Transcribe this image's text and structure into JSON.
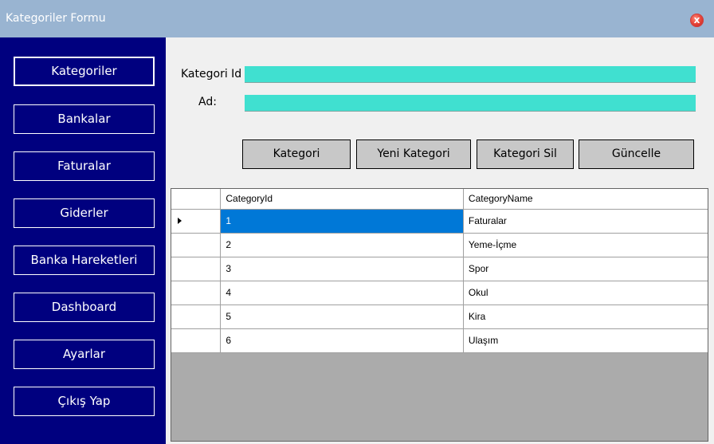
{
  "window": {
    "title": "Kategoriler Formu",
    "close_glyph": "x",
    "close_icon": "close-icon"
  },
  "sidebar": {
    "items": [
      {
        "label": "Kategoriler"
      },
      {
        "label": "Bankalar"
      },
      {
        "label": "Faturalar"
      },
      {
        "label": "Giderler"
      },
      {
        "label": "Banka Hareketleri"
      },
      {
        "label": "Dashboard"
      },
      {
        "label": "Ayarlar"
      },
      {
        "label": "Çıkış Yap"
      }
    ]
  },
  "form": {
    "id_label": "Kategori Id",
    "id_value": "",
    "name_label": "Ad:",
    "name_value": ""
  },
  "actions": {
    "list": "Kategori",
    "add": "Yeni Kategori",
    "delete": "Kategori Sil",
    "update": "Güncelle"
  },
  "grid": {
    "columns": [
      "CategoryId",
      "CategoryName"
    ],
    "rows": [
      {
        "id": "1",
        "name": "Faturalar"
      },
      {
        "id": "2",
        "name": "Yeme-İçme"
      },
      {
        "id": "3",
        "name": "Spor"
      },
      {
        "id": "4",
        "name": "Okul"
      },
      {
        "id": "5",
        "name": "Kira"
      },
      {
        "id": "6",
        "name": "Ulaşım"
      }
    ],
    "selected_row_marker": "row-pointer-icon"
  },
  "colors": {
    "titlebar": "#99b4d1",
    "sidebar": "#00007f",
    "field": "#40e0d0",
    "selection": "#0078d7",
    "grid_background": "#ababab"
  }
}
